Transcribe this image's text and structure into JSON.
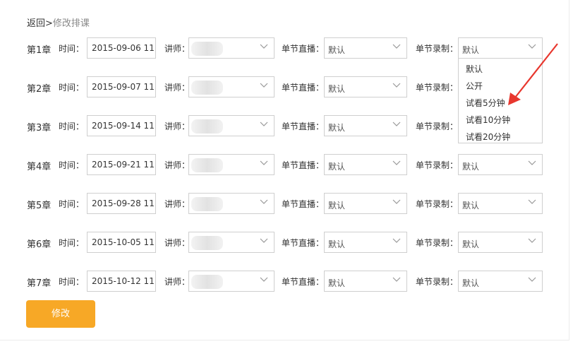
{
  "breadcrumb": {
    "back": "返回",
    "separator": ">",
    "current": "修改排课"
  },
  "labels": {
    "time": "时间：",
    "teacher": "讲师：",
    "live": "单节直播：",
    "record": "单节录制："
  },
  "rows": [
    {
      "chapter": "第1章",
      "time": "2015-09-06 11:",
      "live": "默认",
      "record": "默认"
    },
    {
      "chapter": "第2章",
      "time": "2015-09-07 11:",
      "live": "默认",
      "record": ""
    },
    {
      "chapter": "第3章",
      "time": "2015-09-14 11:",
      "live": "默认",
      "record": ""
    },
    {
      "chapter": "第4章",
      "time": "2015-09-21 11:",
      "live": "默认",
      "record": "默认"
    },
    {
      "chapter": "第5章",
      "time": "2015-09-28 11:",
      "live": "默认",
      "record": "默认"
    },
    {
      "chapter": "第6章",
      "time": "2015-10-05 11:",
      "live": "默认",
      "record": "默认"
    },
    {
      "chapter": "第7章",
      "time": "2015-10-12 11:",
      "live": "默认",
      "record": "默认"
    }
  ],
  "record_dropdown": {
    "options": [
      "默认",
      "公开",
      "试看5分钟",
      "试看10分钟",
      "试看20分钟"
    ]
  },
  "submit_label": "修改",
  "colors": {
    "accent": "#f7a826",
    "arrow": "#e8372e"
  },
  "icons": {
    "select_arrow": "chevron-down-icon",
    "annotation": "red-arrow-icon"
  }
}
